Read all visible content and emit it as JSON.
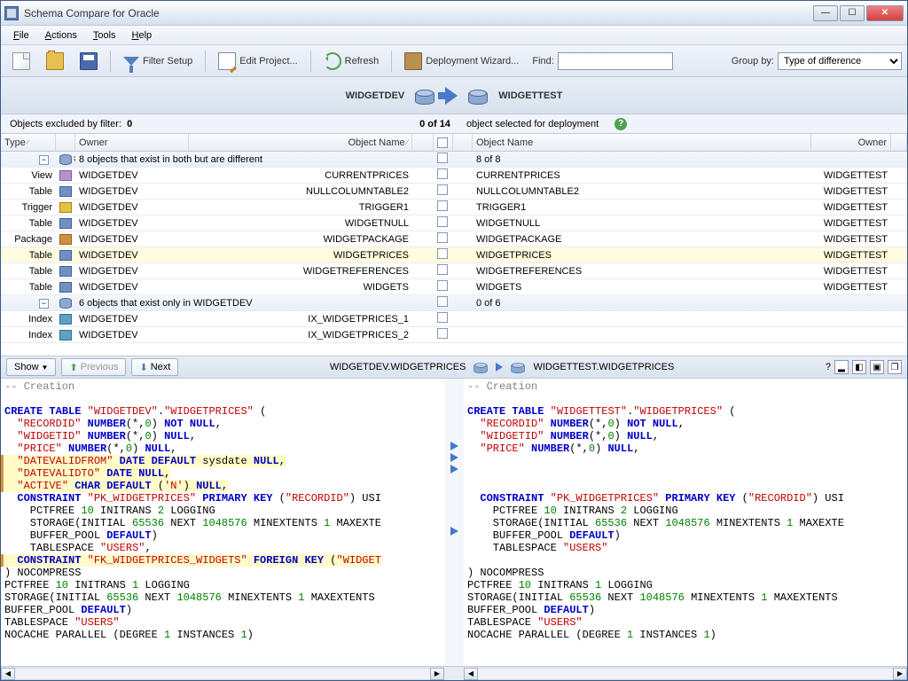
{
  "title": "Schema Compare for Oracle",
  "menu": {
    "file": "File",
    "actions": "Actions",
    "tools": "Tools",
    "help": "Help"
  },
  "toolbar": {
    "filter_setup": "Filter Setup",
    "edit_project": "Edit Project...",
    "refresh": "Refresh",
    "deployment_wizard": "Deployment Wizard...",
    "find": "Find:",
    "group_by": "Group by:",
    "group_by_value": "Type of difference"
  },
  "compare": {
    "left": "WIDGETDEV",
    "right": "WIDGETTEST"
  },
  "status": {
    "excluded_label": "Objects excluded by filter:",
    "excluded_count": "0",
    "selected": "0 of 14",
    "selected_label": "object selected for deployment"
  },
  "headers": {
    "type": "Type",
    "owner_l": "Owner",
    "objname_l": "Object Name",
    "objname_r": "Object Name",
    "owner_r": "Owner"
  },
  "group1": {
    "label": "8 objects that exist in both but are different",
    "count": "8 of 8"
  },
  "rows1": [
    {
      "type": "View",
      "ic": "view",
      "owner_l": "WIDGETDEV",
      "name_l": "CURRENTPRICES",
      "name_r": "CURRENTPRICES",
      "owner_r": "WIDGETTEST"
    },
    {
      "type": "Table",
      "ic": "table",
      "owner_l": "WIDGETDEV",
      "name_l": "NULLCOLUMNTABLE2",
      "name_r": "NULLCOLUMNTABLE2",
      "owner_r": "WIDGETTEST"
    },
    {
      "type": "Trigger",
      "ic": "trigger",
      "owner_l": "WIDGETDEV",
      "name_l": "TRIGGER1",
      "name_r": "TRIGGER1",
      "owner_r": "WIDGETTEST"
    },
    {
      "type": "Table",
      "ic": "table",
      "owner_l": "WIDGETDEV",
      "name_l": "WIDGETNULL",
      "name_r": "WIDGETNULL",
      "owner_r": "WIDGETTEST"
    },
    {
      "type": "Package",
      "ic": "package",
      "owner_l": "WIDGETDEV",
      "name_l": "WIDGETPACKAGE",
      "name_r": "WIDGETPACKAGE",
      "owner_r": "WIDGETTEST"
    },
    {
      "type": "Table",
      "ic": "table",
      "owner_l": "WIDGETDEV",
      "name_l": "WIDGETPRICES",
      "name_r": "WIDGETPRICES",
      "owner_r": "WIDGETTEST",
      "sel": true
    },
    {
      "type": "Table",
      "ic": "table",
      "owner_l": "WIDGETDEV",
      "name_l": "WIDGETREFERENCES",
      "name_r": "WIDGETREFERENCES",
      "owner_r": "WIDGETTEST"
    },
    {
      "type": "Table",
      "ic": "table",
      "owner_l": "WIDGETDEV",
      "name_l": "WIDGETS",
      "name_r": "WIDGETS",
      "owner_r": "WIDGETTEST"
    }
  ],
  "group2": {
    "label": "6 objects that exist only in WIDGETDEV",
    "count": "0 of 6"
  },
  "rows2": [
    {
      "type": "Index",
      "ic": "index",
      "owner_l": "WIDGETDEV",
      "name_l": "IX_WIDGETPRICES_1"
    },
    {
      "type": "Index",
      "ic": "index",
      "owner_l": "WIDGETDEV",
      "name_l": "IX_WIDGETPRICES_2"
    }
  ],
  "diffbar": {
    "show": "Show",
    "previous": "Previous",
    "next": "Next",
    "left": "WIDGETDEV.WIDGETPRICES",
    "right": "WIDGETTEST.WIDGETPRICES"
  }
}
